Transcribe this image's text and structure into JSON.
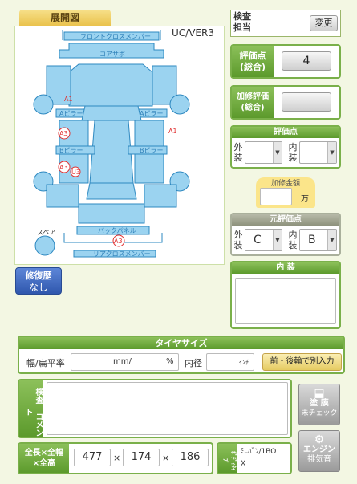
{
  "diagram": {
    "tab_label": "展開図",
    "model_code": "UC/VER3",
    "parts": {
      "front_cross_member": "フロントクロスメンバー",
      "core_support": "コアサポ",
      "a_pillar_left": "Aピラー",
      "a_pillar_right": "Aピラー",
      "b_pillar_left": "Bピラー",
      "b_pillar_right": "Bピラー",
      "back_panel": "バックパネル",
      "rear_cross_member": "リアクロスメンバー",
      "spare": "スペア"
    },
    "marks": {
      "a1_left": "A1",
      "a1_right": "A1",
      "a3_front": "A3",
      "a3_mid": "A3",
      "u3": "U3",
      "a3_rear": "A3"
    }
  },
  "repair_history": {
    "line1": "修復歴",
    "line2": "なし"
  },
  "inspector": {
    "label_line1": "検査",
    "label_line2": "担当",
    "change_button": "変更"
  },
  "rating": {
    "label_line1": "評価点",
    "label_line2": "(総合)",
    "value": "4"
  },
  "repair_rating": {
    "label_line1": "加修評価",
    "label_line2": "(総合)",
    "value": ""
  },
  "score": {
    "title": "評価点",
    "exterior": "外装",
    "interior": "内装",
    "exterior_value": "",
    "interior_value": ""
  },
  "repair_cost": {
    "label": "加修金額",
    "value": "",
    "unit": "万"
  },
  "original_score": {
    "title": "元評価点",
    "exterior": "外装",
    "interior": "内装",
    "exterior_value": "C",
    "interior_value": "B"
  },
  "interior_box": {
    "title": "内 装",
    "value": ""
  },
  "tire": {
    "title": "タイヤサイズ",
    "width_label": "幅/扁平率",
    "mm_unit": "mm/",
    "percent_unit": "%",
    "inner_label": "内径",
    "inch_unit": "ｲﾝﾁ",
    "separate_button": "前・後輪で別入力"
  },
  "comment": {
    "label_line1": "検査",
    "label_line2": "コメント",
    "value": ""
  },
  "paint_button": {
    "line1": "塗 膜",
    "line2": "未チェック"
  },
  "engine_button": {
    "line1": "エンジン",
    "line2": "排気音"
  },
  "dimensions": {
    "label_line1": "全長×全幅",
    "label_line2": "×全高",
    "length": "477",
    "width": "174",
    "height": "186",
    "sep": "×"
  },
  "body_type": {
    "label": "ﾎﾞﾃﾞｨﾀｲﾌﾟ",
    "value_line1": "ﾐﾆﾊﾞﾝ/1BO",
    "value_line2": "X"
  }
}
